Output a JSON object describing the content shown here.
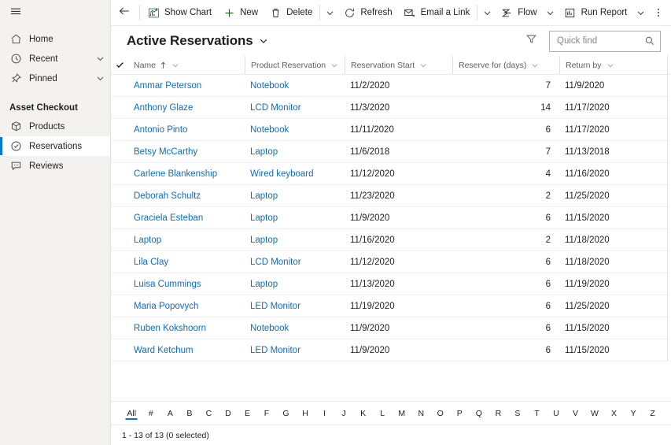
{
  "sidebar": {
    "hamburger_icon": "hamburger-icon",
    "top_items": [
      {
        "label": "Home",
        "icon": "home-icon",
        "chevron": false
      },
      {
        "label": "Recent",
        "icon": "clock-icon",
        "chevron": true
      },
      {
        "label": "Pinned",
        "icon": "pin-icon",
        "chevron": true
      }
    ],
    "group_title": "Asset Checkout",
    "group_items": [
      {
        "label": "Products",
        "icon": "box-icon",
        "selected": false
      },
      {
        "label": "Reservations",
        "icon": "check-circle-icon",
        "selected": true
      },
      {
        "label": "Reviews",
        "icon": "comment-icon",
        "selected": false
      }
    ]
  },
  "commandbar": {
    "back_label": "Back",
    "items": [
      {
        "label": "Show Chart",
        "icon": "chart-icon",
        "caret": false
      },
      {
        "label": "New",
        "icon": "plus-icon",
        "caret": false
      },
      {
        "label": "Delete",
        "icon": "trash-icon",
        "caret": false,
        "separator_after": true,
        "caret_standalone": true
      },
      {
        "label": "Refresh",
        "icon": "refresh-icon",
        "caret": false
      },
      {
        "label": "Email a Link",
        "icon": "email-icon",
        "caret": false,
        "separator_after": true,
        "caret_standalone": true
      },
      {
        "label": "Flow",
        "icon": "flow-icon",
        "caret": true
      },
      {
        "label": "Run Report",
        "icon": "report-icon",
        "caret": true
      }
    ],
    "overflow_label": "More commands"
  },
  "view": {
    "title": "Active Reservations",
    "title_caret_icon": "chevron-down-icon",
    "filter_icon": "filter-icon",
    "search": {
      "placeholder": "Quick find",
      "value": "",
      "icon": "search-icon"
    }
  },
  "grid": {
    "select_all_icon": "checkmark-icon",
    "columns": [
      {
        "key": "name",
        "label": "Name",
        "sorted": true,
        "sort_icon": "sort-asc-icon",
        "chevron": true,
        "align": "left"
      },
      {
        "key": "prod",
        "label": "Product Reservation",
        "sorted": false,
        "chevron": true,
        "align": "left"
      },
      {
        "key": "start",
        "label": "Reservation Start",
        "sorted": false,
        "chevron": true,
        "align": "left"
      },
      {
        "key": "days",
        "label": "Reserve for (days)",
        "sorted": false,
        "chevron": true,
        "align": "left"
      },
      {
        "key": "ret",
        "label": "Return by",
        "sorted": false,
        "chevron": true,
        "align": "left"
      }
    ],
    "rows": [
      {
        "name": "Ammar Peterson",
        "prod": "Notebook",
        "start": "11/2/2020",
        "days": "7",
        "ret": "11/9/2020"
      },
      {
        "name": "Anthony Glaze",
        "prod": "LCD Monitor",
        "start": "11/3/2020",
        "days": "14",
        "ret": "11/17/2020"
      },
      {
        "name": "Antonio Pinto",
        "prod": "Notebook",
        "start": "11/11/2020",
        "days": "6",
        "ret": "11/17/2020"
      },
      {
        "name": "Betsy McCarthy",
        "prod": "Laptop",
        "start": "11/6/2018",
        "days": "7",
        "ret": "11/13/2018"
      },
      {
        "name": "Carlene Blankenship",
        "prod": "Wired keyboard",
        "start": "11/12/2020",
        "days": "4",
        "ret": "11/16/2020"
      },
      {
        "name": "Deborah Schultz",
        "prod": "Laptop",
        "start": "11/23/2020",
        "days": "2",
        "ret": "11/25/2020"
      },
      {
        "name": "Graciela Esteban",
        "prod": "Laptop",
        "start": "11/9/2020",
        "days": "6",
        "ret": "11/15/2020"
      },
      {
        "name": "Laptop",
        "prod": "Laptop",
        "start": "11/16/2020",
        "days": "2",
        "ret": "11/18/2020"
      },
      {
        "name": "Lila Clay",
        "prod": "LCD Monitor",
        "start": "11/12/2020",
        "days": "6",
        "ret": "11/18/2020"
      },
      {
        "name": "Luisa Cummings",
        "prod": "Laptop",
        "start": "11/13/2020",
        "days": "6",
        "ret": "11/19/2020"
      },
      {
        "name": "Maria Popovych",
        "prod": "LED Monitor",
        "start": "11/19/2020",
        "days": "6",
        "ret": "11/25/2020"
      },
      {
        "name": "Ruben Kokshoorn",
        "prod": "Notebook",
        "start": "11/9/2020",
        "days": "6",
        "ret": "11/15/2020"
      },
      {
        "name": "Ward Ketchum",
        "prod": "LED Monitor",
        "start": "11/9/2020",
        "days": "6",
        "ret": "11/15/2020"
      }
    ]
  },
  "alphabar": {
    "active": "All",
    "letters": [
      "All",
      "#",
      "A",
      "B",
      "C",
      "D",
      "E",
      "F",
      "G",
      "H",
      "I",
      "J",
      "K",
      "L",
      "M",
      "N",
      "O",
      "P",
      "Q",
      "R",
      "S",
      "T",
      "U",
      "V",
      "W",
      "X",
      "Y",
      "Z"
    ]
  },
  "status": {
    "record_count": "1 - 13 of 13 (0 selected)"
  },
  "colors": {
    "accent": "#0078d4",
    "link": "#0f6cbd",
    "sidebar_bg": "#f3f2f1",
    "new_green": "#0b6a0b",
    "text": "#201f1e"
  }
}
